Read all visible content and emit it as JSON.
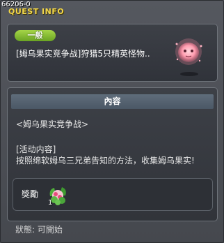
{
  "header": {
    "quest_id": "66206-0",
    "title": "QUEST INFO"
  },
  "summary": {
    "category": "一般",
    "quest_name": "[姆乌果实竞争战]狩猎5只精英怪物.."
  },
  "content": {
    "header": "內容",
    "lines": [
      "<姆乌果实竞争战>",
      "",
      "[活动内容]",
      "按照绵软姆乌三兄弟告知的方法，收集姆乌果实!"
    ]
  },
  "reward": {
    "label": "獎勵",
    "item_icon": "fruit-icon",
    "quantity": "1"
  },
  "status": {
    "text": "狀態:  可開始"
  },
  "colors": {
    "title": "#f2d74a",
    "badge": "#8cc63f",
    "section_header": "#56636f"
  }
}
